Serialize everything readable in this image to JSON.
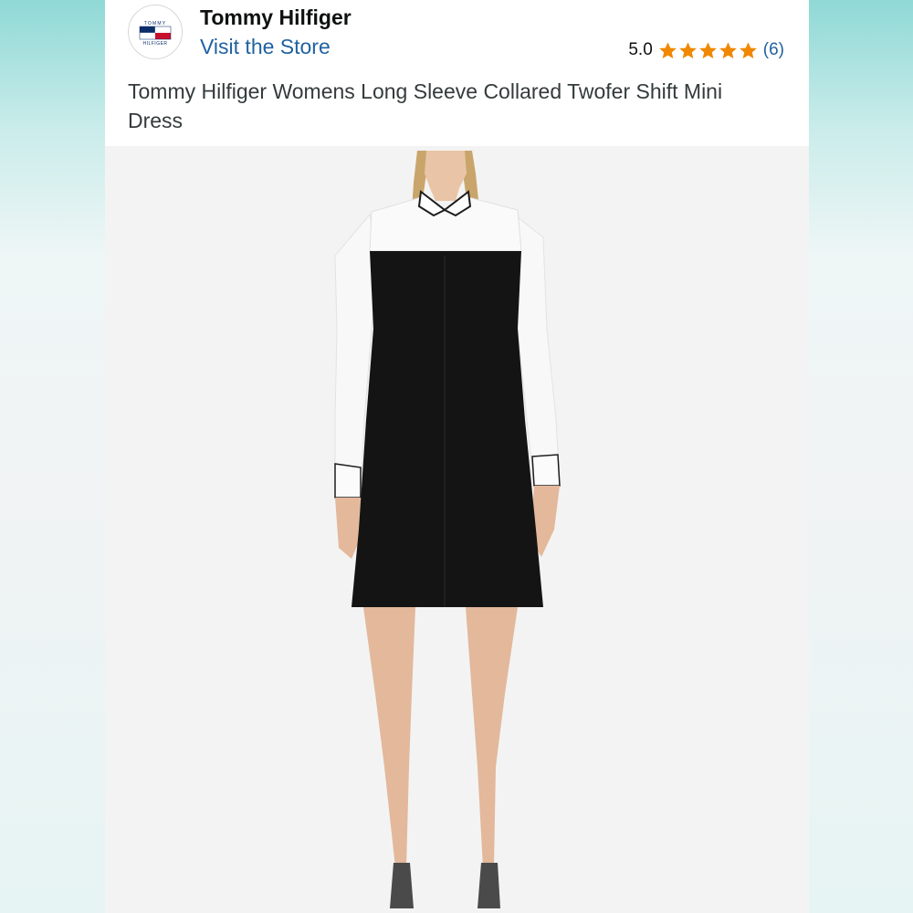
{
  "store": {
    "brand_name": "Tommy Hilfiger",
    "visit_label": "Visit the Store",
    "logo_text_top": "TOMMY",
    "logo_text_bottom": "HILFIGER"
  },
  "rating": {
    "value": "5.0",
    "stars": 5,
    "count": "(6)",
    "star_color": "#f08804"
  },
  "product": {
    "title": "Tommy Hilfiger Womens Long Sleeve Collared Twofer Shift Mini Dress",
    "image": "product photo: model wearing black shift dress with white collared long sleeves"
  },
  "colors": {
    "link": "#2162a1",
    "brand_navy": "#0b2c6b",
    "brand_red": "#c8102e"
  }
}
